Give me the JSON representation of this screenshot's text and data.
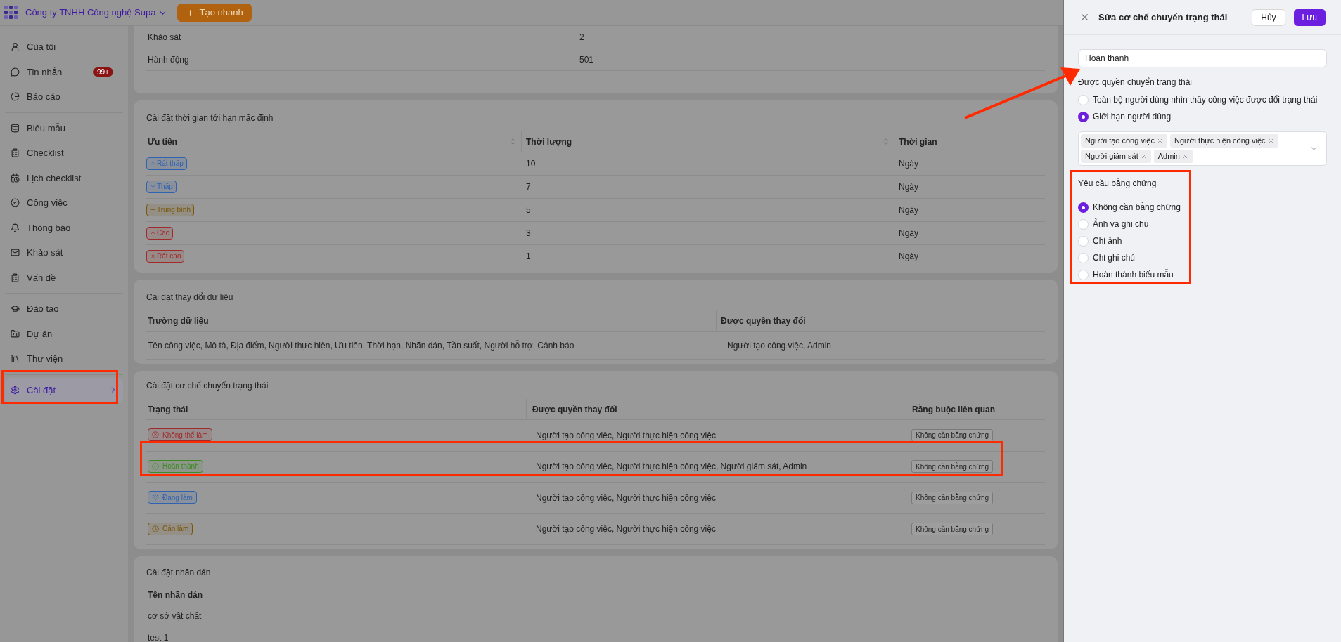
{
  "header": {
    "company": "Công ty TNHH Công nghệ Supa",
    "quick_create": "Tạo nhanh"
  },
  "sidebar": {
    "groups": [
      [
        {
          "label": "Cùa tôi",
          "selected": false
        },
        {
          "label": "Tin nhắn",
          "badge": "99+",
          "selected": false
        },
        {
          "label": "Báo cáo",
          "selected": false
        }
      ],
      [
        {
          "label": "Biểu mẫu",
          "selected": false
        },
        {
          "label": "Checklist",
          "selected": false
        },
        {
          "label": "Lịch checklist",
          "selected": false
        },
        {
          "label": "Công việc",
          "selected": false
        },
        {
          "label": "Thông báo",
          "selected": false
        },
        {
          "label": "Khảo sát",
          "selected": false
        },
        {
          "label": "Vấn đề",
          "selected": false
        }
      ],
      [
        {
          "label": "Đào tạo",
          "selected": false
        },
        {
          "label": "Dự án",
          "selected": false
        },
        {
          "label": "Thư viện",
          "selected": false
        }
      ],
      [
        {
          "label": "Cài đặt",
          "selected": true,
          "expandable": true
        }
      ]
    ]
  },
  "stats_card": {
    "rows": [
      {
        "name": "Khảo sát",
        "value": "2"
      },
      {
        "name": "Hành động",
        "value": "501"
      }
    ]
  },
  "deadline_card": {
    "title": "Cài đặt thời gian tới hạn mặc định",
    "columns": [
      {
        "label": "Ưu tiên",
        "sortable": true
      },
      {
        "label": "Thời lượng",
        "sortable": true
      },
      {
        "label": "Thời gian",
        "sortable": false
      }
    ],
    "rows": [
      {
        "priority": {
          "label": "Rất thấp",
          "kind": "very_low",
          "color": "#2f62b0"
        },
        "duration": "10",
        "unit": "Ngày"
      },
      {
        "priority": {
          "label": "Thấp",
          "kind": "low",
          "color": "#2f62b0"
        },
        "duration": "7",
        "unit": "Ngày"
      },
      {
        "priority": {
          "label": "Trung bình",
          "kind": "medium",
          "color": "#7a5608"
        },
        "duration": "5",
        "unit": "Ngày"
      },
      {
        "priority": {
          "label": "Cao",
          "kind": "high",
          "color": "#a02a2a"
        },
        "duration": "3",
        "unit": "Ngày"
      },
      {
        "priority": {
          "label": "Rất cao",
          "kind": "very_high",
          "color": "#a02a2a"
        },
        "duration": "1",
        "unit": "Ngày"
      }
    ]
  },
  "data_card": {
    "title": "Cài đặt thay đổi dữ liệu",
    "columns": [
      "Trường dữ liệu",
      "Được quyền thay đổi"
    ],
    "rows": [
      [
        "Tên công việc, Mô tả, Địa điểm, Người thực hiện, Ưu tiên, Thời hạn, Nhãn dán, Tần suất, Người hỗ trợ, Cảnh báo",
        "Người tạo công việc, Admin"
      ]
    ]
  },
  "status_card": {
    "title": "Cài đặt cơ chế chuyển trạng thái",
    "columns": [
      "Trạng thái",
      "Được quyền thay đổi",
      "Rằng buộc liên quan"
    ],
    "rows": [
      {
        "status": {
          "label": "Không thể làm",
          "kind": "blocked",
          "color": "#9c2b2b"
        },
        "permitted": "Người tạo công việc, Người thực hiện công việc",
        "constraint": "Không cần bằng chứng"
      },
      {
        "status": {
          "label": "Hoàn thành",
          "kind": "done",
          "color": "#3d8a25"
        },
        "permitted": "Người tạo công việc, Người thực hiện công việc, Người giám sát, Admin",
        "constraint": "Không cần bằng chứng"
      },
      {
        "status": {
          "label": "Đang làm",
          "kind": "in_progress",
          "color": "#2f62b0"
        },
        "permitted": "Người tạo công việc, Người thực hiện công việc",
        "constraint": "Không cần bằng chứng"
      },
      {
        "status": {
          "label": "Cần làm",
          "kind": "todo",
          "color": "#7a5608"
        },
        "permitted": "Người tạo công việc, Người thực hiện công việc",
        "constraint": "Không cần bằng chứng"
      }
    ]
  },
  "labels_card": {
    "title": "Cài đặt nhãn dán",
    "column": "Tên nhãn dán",
    "rows": [
      "cơ sở vật chất",
      "test 1"
    ]
  },
  "drawer": {
    "title": "Sửa cơ chế chuyển trạng thái",
    "cancel": "Hủy",
    "save": "Lưu",
    "name_value": "Hoàn thành",
    "permission_label": "Được quyền chuyển trạng thái",
    "permission_options": [
      {
        "label": "Toàn bộ người dùng nhìn thấy công việc được đổi trạng thái",
        "selected": false
      },
      {
        "label": "Giới hạn người dùng",
        "selected": true
      }
    ],
    "tags": [
      "Người tạo công việc",
      "Người thực hiện công việc",
      "Người giám sát",
      "Admin"
    ],
    "evidence_label": "Yêu cầu bằng chứng",
    "evidence_options": [
      {
        "label": "Không cần bằng chứng",
        "selected": true
      },
      {
        "label": "Ảnh và ghi chú",
        "selected": false
      },
      {
        "label": "Chỉ ảnh",
        "selected": false
      },
      {
        "label": "Chỉ ghi chú",
        "selected": false
      },
      {
        "label": "Hoàn thành biểu mẫu",
        "selected": false
      }
    ]
  }
}
